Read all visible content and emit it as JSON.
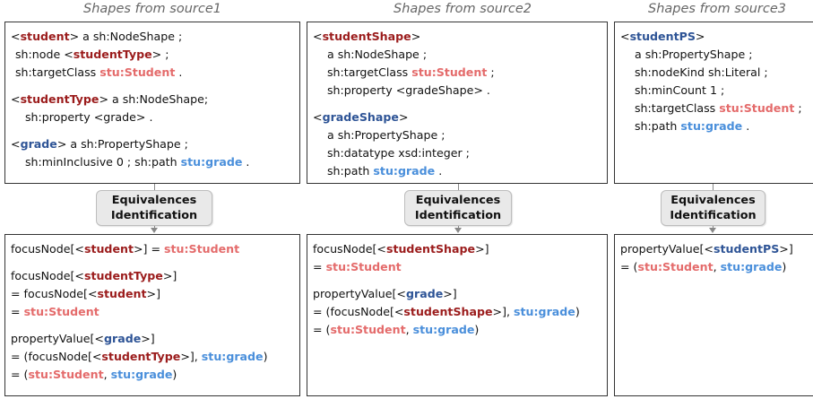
{
  "columns": [
    {
      "title": "Shapes from source1",
      "shapes": [
        [
          {
            "t": "<"
          },
          {
            "t": "student",
            "c": "red"
          },
          {
            "t": "> a sh:NodeShape ;"
          }
        ],
        [
          {
            "t": "sh:node <"
          },
          {
            "t": "studentType",
            "c": "red"
          },
          {
            "t": "> ;"
          }
        ],
        [
          {
            "t": "sh:targetClass "
          },
          {
            "t": "stu:Student",
            "c": "salmon"
          },
          {
            "t": " ."
          }
        ],
        null,
        [
          {
            "t": "<"
          },
          {
            "t": "studentType",
            "c": "red"
          },
          {
            "t": "> a sh:NodeShape;"
          }
        ],
        [
          {
            "t": "sh:property <grade> ."
          }
        ],
        null,
        [
          {
            "t": "<"
          },
          {
            "t": "grade",
            "c": "blue"
          },
          {
            "t": "> a sh:PropertyShape ;"
          }
        ],
        [
          {
            "t": "sh:minInclusive 0 ; sh:path "
          },
          {
            "t": "stu:grade",
            "c": "sky"
          },
          {
            "t": " ."
          }
        ]
      ],
      "shape_indent": [
        0,
        1,
        1,
        0,
        0,
        2,
        0,
        0,
        2
      ],
      "equivalences": [
        [
          {
            "t": "focusNode[<"
          },
          {
            "t": "student",
            "c": "red"
          },
          {
            "t": ">] = "
          },
          {
            "t": "stu:Student",
            "c": "salmon"
          }
        ],
        null,
        [
          {
            "t": "focusNode[<"
          },
          {
            "t": "studentType",
            "c": "red"
          },
          {
            "t": ">]"
          }
        ],
        [
          {
            "t": " = focusNode[<"
          },
          {
            "t": "student",
            "c": "red"
          },
          {
            "t": ">]"
          }
        ],
        [
          {
            "t": " = "
          },
          {
            "t": "stu:Student",
            "c": "salmon"
          }
        ],
        null,
        [
          {
            "t": "propertyValue[<"
          },
          {
            "t": "grade",
            "c": "blue"
          },
          {
            "t": ">]"
          }
        ],
        [
          {
            "t": " = (focusNode[<"
          },
          {
            "t": "studentType",
            "c": "red"
          },
          {
            "t": ">], "
          },
          {
            "t": "stu:grade",
            "c": "sky"
          },
          {
            "t": ")"
          }
        ],
        [
          {
            "t": " = ("
          },
          {
            "t": "stu:Student",
            "c": "salmon"
          },
          {
            "t": ", "
          },
          {
            "t": "stu:grade",
            "c": "sky"
          },
          {
            "t": ")"
          }
        ]
      ]
    },
    {
      "title": "Shapes from source2",
      "shapes": [
        [
          {
            "t": "<"
          },
          {
            "t": "studentShape",
            "c": "red"
          },
          {
            "t": ">"
          }
        ],
        [
          {
            "t": "a sh:NodeShape ;"
          }
        ],
        [
          {
            "t": "sh:targetClass "
          },
          {
            "t": "stu:Student",
            "c": "salmon"
          },
          {
            "t": " ;"
          }
        ],
        [
          {
            "t": "sh:property <gradeShape> ."
          }
        ],
        null,
        [
          {
            "t": "<"
          },
          {
            "t": "gradeShape",
            "c": "blue"
          },
          {
            "t": ">"
          }
        ],
        [
          {
            "t": "a sh:PropertyShape ;"
          }
        ],
        [
          {
            "t": "sh:datatype xsd:integer ;"
          }
        ],
        [
          {
            "t": "sh:path "
          },
          {
            "t": "stu:grade",
            "c": "sky"
          },
          {
            "t": " ."
          }
        ]
      ],
      "shape_indent": [
        0,
        2,
        2,
        2,
        0,
        0,
        2,
        2,
        2
      ],
      "equivalences": [
        [
          {
            "t": "focusNode[<"
          },
          {
            "t": "studentShape",
            "c": "red"
          },
          {
            "t": ">]"
          }
        ],
        [
          {
            "t": " = "
          },
          {
            "t": "stu:Student",
            "c": "salmon"
          }
        ],
        null,
        [
          {
            "t": "propertyValue[<"
          },
          {
            "t": "grade",
            "c": "blue"
          },
          {
            "t": ">]"
          }
        ],
        [
          {
            "t": " = (focusNode[<"
          },
          {
            "t": "studentShape",
            "c": "red"
          },
          {
            "t": ">], "
          },
          {
            "t": "stu:grade",
            "c": "sky"
          },
          {
            "t": ")"
          }
        ],
        [
          {
            "t": " = ("
          },
          {
            "t": "stu:Student",
            "c": "salmon"
          },
          {
            "t": ", "
          },
          {
            "t": "stu:grade",
            "c": "sky"
          },
          {
            "t": ")"
          }
        ]
      ]
    },
    {
      "title": "Shapes from source3",
      "shapes": [
        [
          {
            "t": "<"
          },
          {
            "t": "studentPS",
            "c": "blue"
          },
          {
            "t": ">"
          }
        ],
        [
          {
            "t": "a sh:PropertyShape ;"
          }
        ],
        [
          {
            "t": "sh:nodeKind sh:Literal ;"
          }
        ],
        [
          {
            "t": "sh:minCount 1 ;"
          }
        ],
        [
          {
            "t": "sh:targetClass "
          },
          {
            "t": "stu:Student",
            "c": "salmon"
          },
          {
            "t": " ;"
          }
        ],
        [
          {
            "t": "sh:path "
          },
          {
            "t": "stu:grade",
            "c": "sky"
          },
          {
            "t": " ."
          }
        ]
      ],
      "shape_indent": [
        0,
        2,
        2,
        2,
        2,
        2
      ],
      "equivalences": [
        [
          {
            "t": "propertyValue[<"
          },
          {
            "t": "studentPS",
            "c": "blue"
          },
          {
            "t": ">]"
          }
        ],
        [
          {
            "t": " = ("
          },
          {
            "t": "stu:Student",
            "c": "salmon"
          },
          {
            "t": ", "
          },
          {
            "t": "stu:grade",
            "c": "sky"
          },
          {
            "t": ")"
          }
        ]
      ]
    }
  ],
  "step_label_line1": "Equivalences",
  "step_label_line2": "Identification",
  "colors": {
    "shape_name_red": "#9b1c1c",
    "property_shape_blue": "#2e5496",
    "class_salmon": "#e46b6b",
    "path_sky": "#4a8fdb",
    "title_gray": "#666666",
    "pill_bg": "#e9e9e9"
  }
}
